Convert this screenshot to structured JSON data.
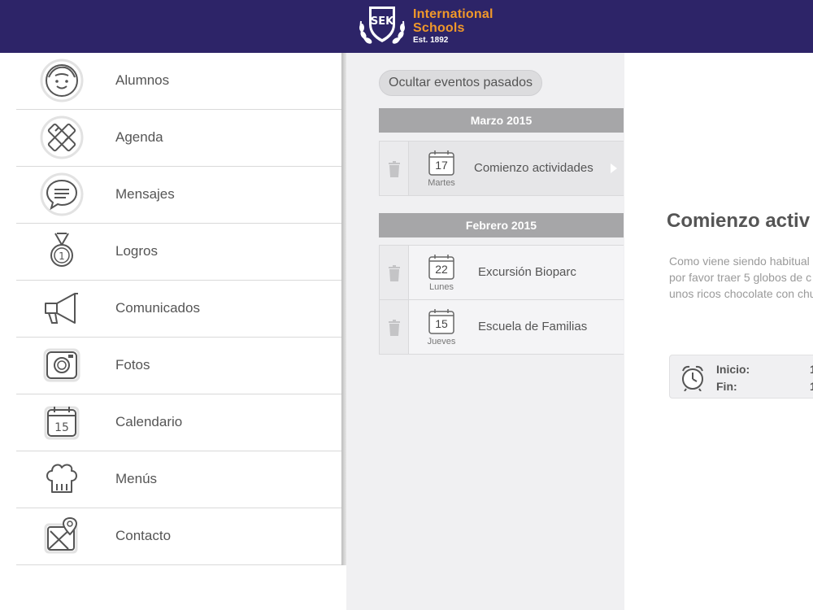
{
  "header": {
    "logo_mark": "SEK",
    "logo_line1": "International",
    "logo_line2": "Schools",
    "logo_est": "Est. 1892",
    "bg_color": "#2d2468",
    "accent_color": "#f0982a"
  },
  "sidebar": {
    "items": [
      {
        "label": "Alumnos",
        "icon": "student-face-icon"
      },
      {
        "label": "Agenda",
        "icon": "pencil-ruler-icon"
      },
      {
        "label": "Mensajes",
        "icon": "chat-bubble-icon"
      },
      {
        "label": "Logros",
        "icon": "medal-icon"
      },
      {
        "label": "Comunicados",
        "icon": "megaphone-icon"
      },
      {
        "label": "Fotos",
        "icon": "camera-icon"
      },
      {
        "label": "Calendario",
        "icon": "calendar-icon"
      },
      {
        "label": "Menús",
        "icon": "chef-hat-icon"
      },
      {
        "label": "Contacto",
        "icon": "map-pin-icon"
      }
    ]
  },
  "events": {
    "hide_past_label": "Ocultar eventos pasados",
    "groups": [
      {
        "month": "Marzo 2015",
        "items": [
          {
            "day_num": "17",
            "weekday": "Martes",
            "title": "Comienzo actividades",
            "selected": true
          }
        ]
      },
      {
        "month": "Febrero 2015",
        "items": [
          {
            "day_num": "22",
            "weekday": "Lunes",
            "title": "Excursión Bioparc",
            "selected": false
          },
          {
            "day_num": "15",
            "weekday": "Jueves",
            "title": "Escuela de Familias",
            "selected": false
          }
        ]
      }
    ]
  },
  "detail": {
    "title": "Comienzo activ",
    "desc_line1": "Como viene siendo habitual",
    "desc_line2": "por favor traer 5 globos de c",
    "desc_line3": "unos ricos chocolate con chu",
    "start_label": "Inicio:",
    "start_value": "1",
    "end_label": "Fin:",
    "end_value": "1"
  },
  "calendar_icon_num": "15"
}
